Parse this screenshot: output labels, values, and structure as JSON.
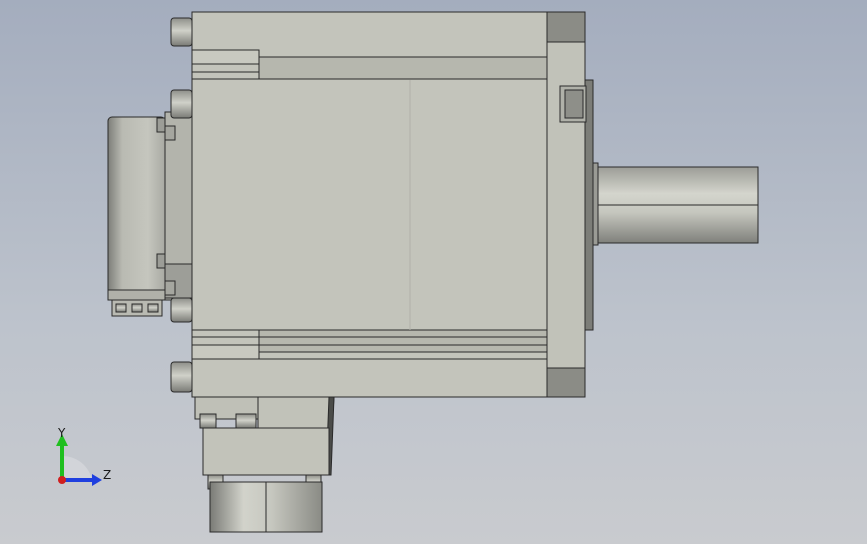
{
  "viewport": {
    "type": "cad-3d-viewport",
    "view": "side-elevation",
    "background_top": "#a4adbe",
    "background_bottom": "#c9cbcf"
  },
  "part": {
    "name": "servo-motor",
    "body_color": "#c3c4bb",
    "edge_color": "#2a2a2a",
    "dark_face_color": "#8a8b86"
  },
  "triad": {
    "y_label": "Y",
    "z_label": "Z",
    "y_color": "#1fbf1f",
    "z_color": "#1f3fdf",
    "origin_color": "#d01f1f"
  }
}
